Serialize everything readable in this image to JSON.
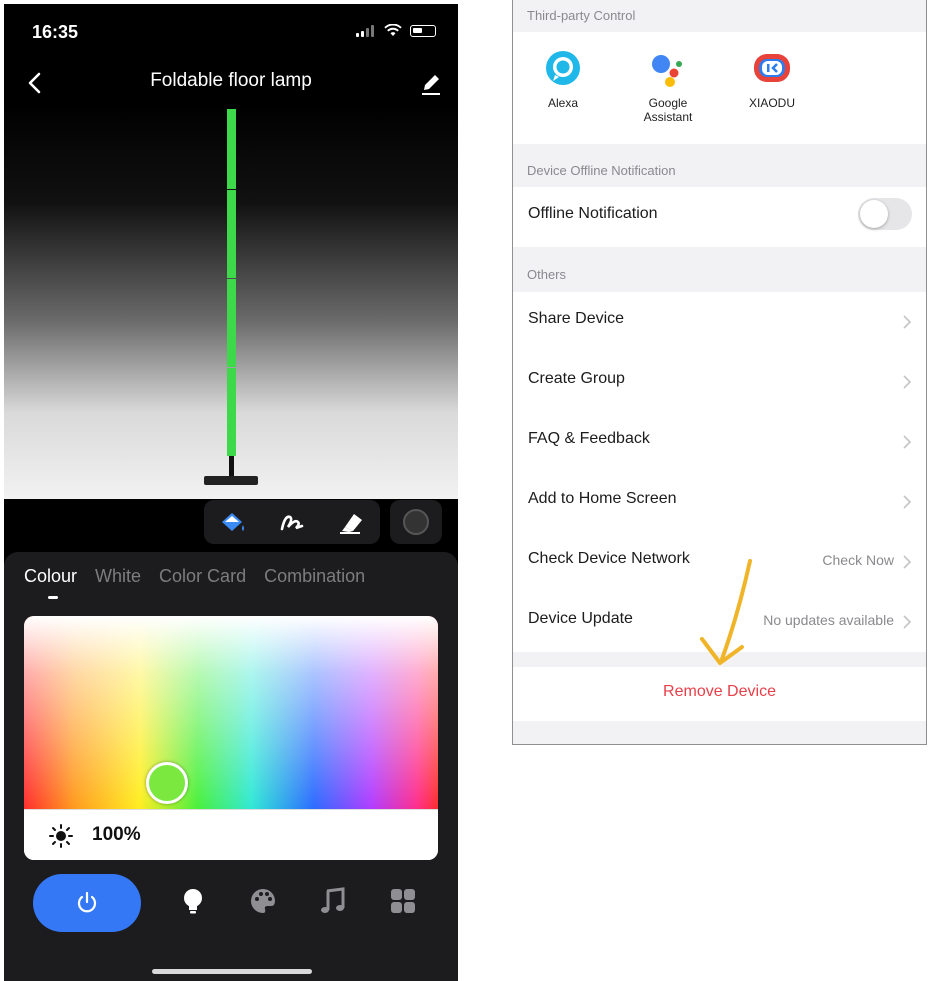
{
  "status_bar": {
    "time": "16:35"
  },
  "lamp_screen": {
    "title": "Foldable floor lamp",
    "tabs": [
      {
        "label": "Colour",
        "active": true
      },
      {
        "label": "White",
        "active": false
      },
      {
        "label": "Color Card",
        "active": false
      },
      {
        "label": "Combination",
        "active": false
      }
    ],
    "brightness": "100%",
    "selected_color": "#7be840",
    "accent_color": "#3478f6",
    "toolbar_icons": [
      "paint-bucket-icon",
      "brush-icon",
      "eraser-icon",
      "record-icon"
    ],
    "bottom_icons": [
      "power-icon",
      "bulb-icon",
      "palette-icon",
      "music-icon",
      "grid-icon"
    ]
  },
  "settings": {
    "third_party_header": "Third-party Control",
    "third_party": [
      {
        "name": "Alexa",
        "icon": "alexa-icon"
      },
      {
        "name": "Google\nAssistant",
        "icon": "google-assistant-icon"
      },
      {
        "name": "XIAODU",
        "icon": "xiaodu-icon"
      }
    ],
    "offline_header": "Device Offline Notification",
    "offline_label": "Offline Notification",
    "offline_enabled": false,
    "others_header": "Others",
    "rows": [
      {
        "label": "Share Device",
        "value": ""
      },
      {
        "label": "Create Group",
        "value": ""
      },
      {
        "label": "FAQ & Feedback",
        "value": ""
      },
      {
        "label": "Add to Home Screen",
        "value": ""
      },
      {
        "label": "Check Device Network",
        "value": "Check Now"
      },
      {
        "label": "Device Update",
        "value": "No updates available"
      }
    ],
    "remove_label": "Remove Device",
    "remove_color": "#e6414a",
    "annotation_color": "#f0b429"
  }
}
